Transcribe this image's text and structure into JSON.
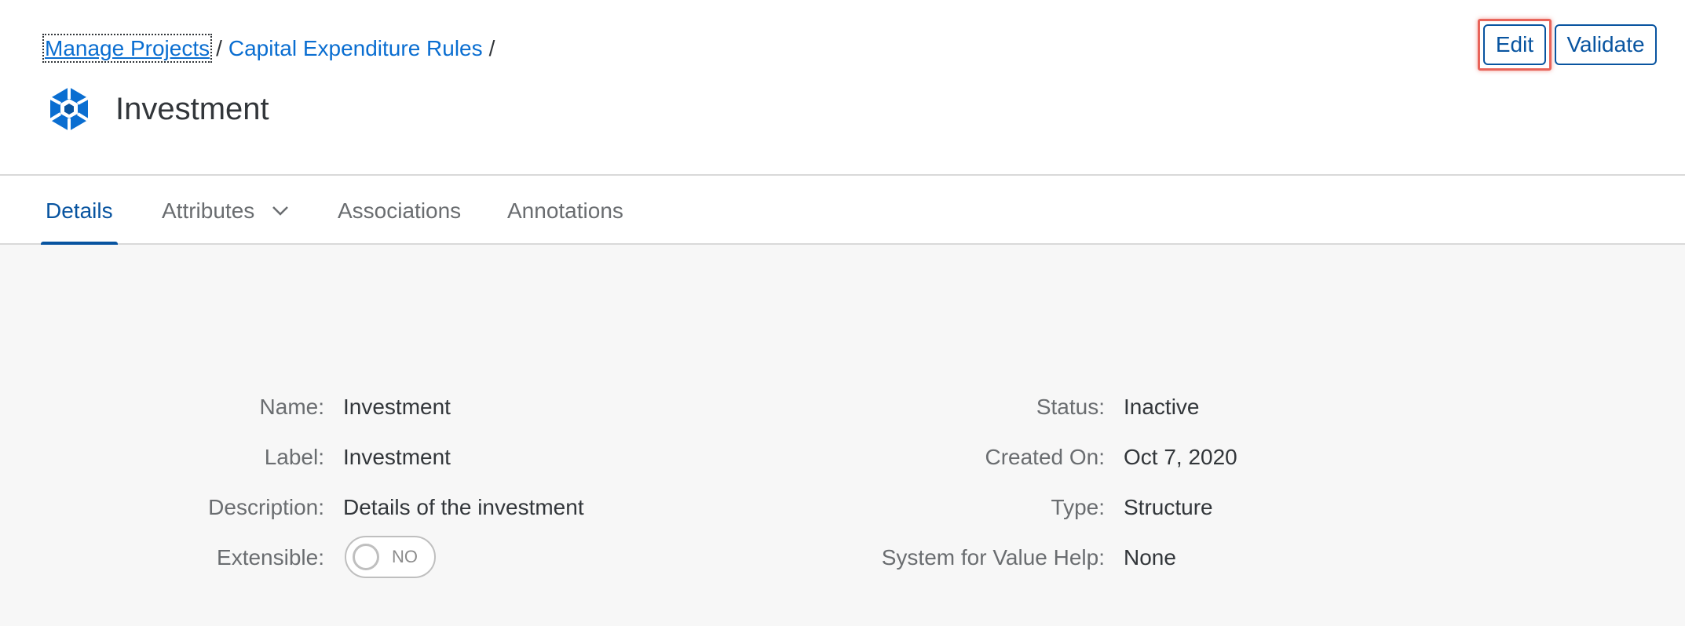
{
  "breadcrumb": {
    "items": [
      "Manage Projects",
      "Capital Expenditure Rules"
    ],
    "separator": "/"
  },
  "header": {
    "title": "Investment",
    "icon": "cube-structure-icon"
  },
  "actions": {
    "edit_label": "Edit",
    "validate_label": "Validate"
  },
  "tabs": [
    {
      "label": "Details",
      "active": true
    },
    {
      "label": "Attributes",
      "active": false,
      "has_dropdown": true
    },
    {
      "label": "Associations",
      "active": false
    },
    {
      "label": "Annotations",
      "active": false
    }
  ],
  "details": {
    "left": [
      {
        "label": "Name:",
        "value": "Investment"
      },
      {
        "label": "Label:",
        "value": "Investment"
      },
      {
        "label": "Description:",
        "value": "Details of the investment"
      },
      {
        "label": "Extensible:",
        "value": "NO"
      }
    ],
    "right": [
      {
        "label": "Status:",
        "value": "Inactive"
      },
      {
        "label": "Created On:",
        "value": "Oct 7, 2020"
      },
      {
        "label": "Type:",
        "value": "Structure"
      },
      {
        "label": "System for Value Help:",
        "value": "None"
      }
    ]
  },
  "colors": {
    "brand_blue": "#0854a0",
    "link_blue": "#0a6ed1",
    "highlight_red": "#e8645a",
    "content_bg": "#f7f7f7"
  }
}
